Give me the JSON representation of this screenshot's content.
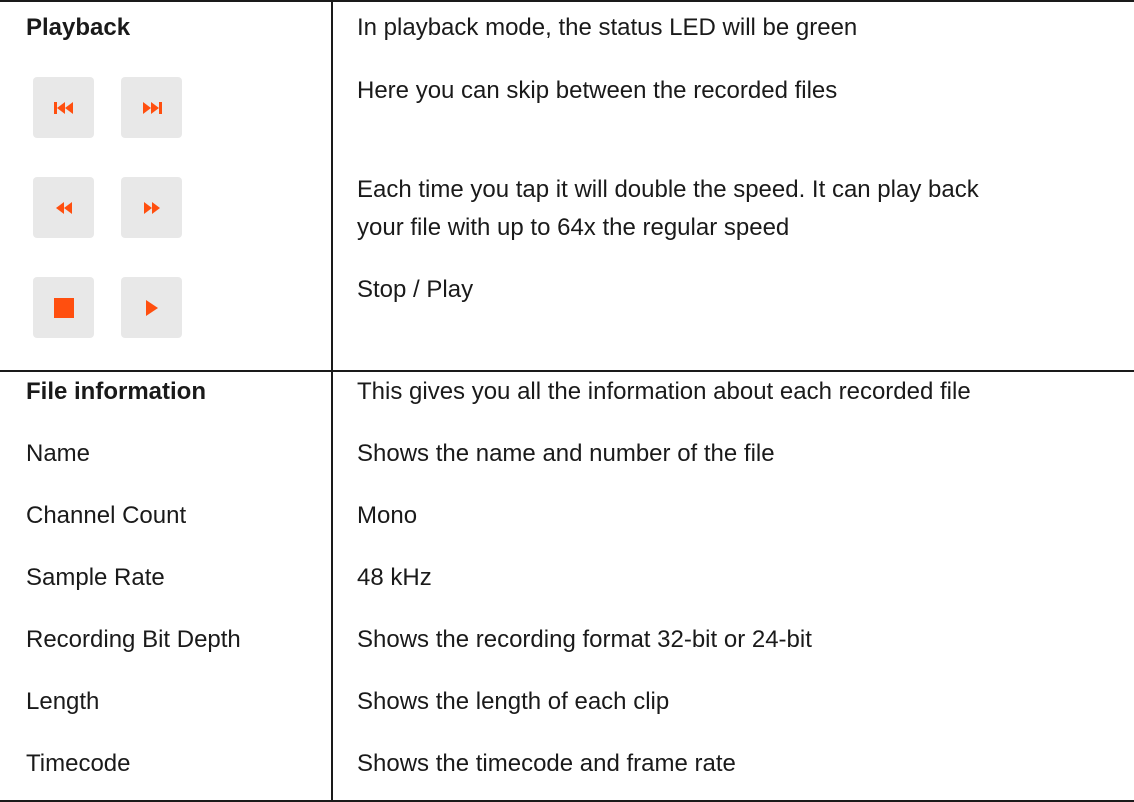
{
  "playback": {
    "title": "Playback",
    "status_desc": "In playback mode, the status LED will be green",
    "skip_desc": "Here you can skip between the recorded files",
    "speed_desc_line1": "Each time you tap it will double the speed. It can play back",
    "speed_desc_line2": "your file with up to 64x the regular speed",
    "stopplay_desc": "Stop / Play",
    "icons": [
      "skip-back-icon",
      "skip-forward-icon",
      "rewind-icon",
      "fast-forward-icon",
      "stop-icon",
      "play-icon"
    ],
    "accent_color": "#ff4f0f",
    "button_bg": "#e8e8e8"
  },
  "file_info": {
    "title": "File information",
    "title_desc": "This gives you all the information about each recorded file",
    "rows": [
      {
        "label": "Name",
        "desc": "Shows the name and number of the file"
      },
      {
        "label": "Channel Count",
        "desc": "Mono"
      },
      {
        "label": "Sample Rate",
        "desc": "48 kHz"
      },
      {
        "label": "Recording Bit Depth",
        "desc": "Shows the recording format 32-bit or 24-bit"
      },
      {
        "label": "Length",
        "desc": "Shows the length of each clip"
      },
      {
        "label": "Timecode",
        "desc": "Shows the timecode and frame rate"
      }
    ]
  }
}
